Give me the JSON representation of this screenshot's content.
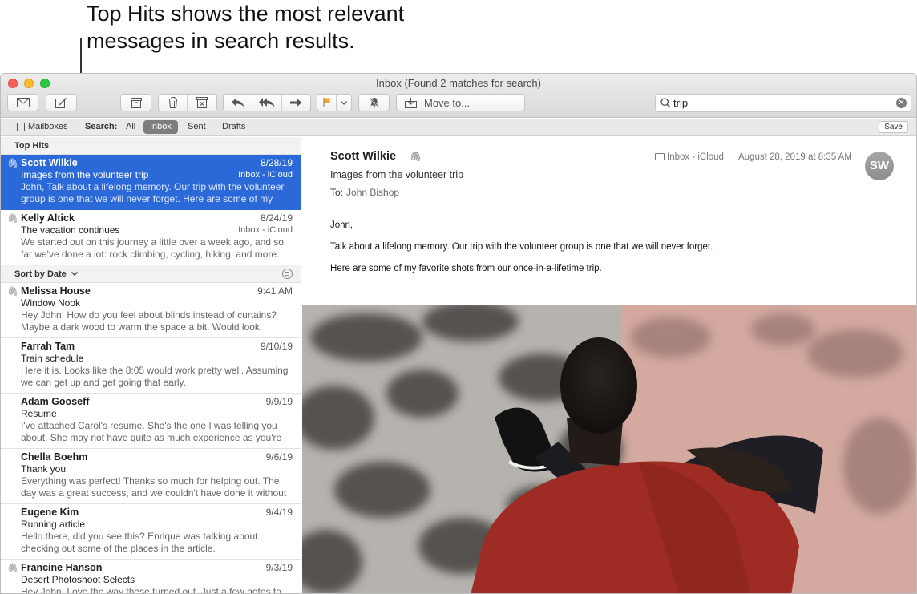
{
  "callout": {
    "line1": "Top Hits shows the most relevant",
    "line2": "messages in search results."
  },
  "window": {
    "title": "Inbox (Found 2 matches for search)"
  },
  "toolbar": {
    "move_to_label": "Move to...",
    "search_value": "trip"
  },
  "scopebar": {
    "mailboxes_label": "Mailboxes",
    "search_label": "Search:",
    "scopes": [
      "All",
      "Inbox",
      "Sent",
      "Drafts"
    ],
    "active_scope": "Inbox",
    "save_label": "Save"
  },
  "list": {
    "top_hits_label": "Top Hits",
    "sort_label": "Sort by Date",
    "top_hits": [
      {
        "sender": "Scott Wilkie",
        "date": "8/28/19",
        "subject": "Images from the volunteer trip",
        "mailbox": "Inbox - iCloud",
        "preview": "John, Talk about a lifelong memory. Our trip with the volunteer group is one that we will never forget. Here are some of my favorite shots.",
        "attachment": true
      },
      {
        "sender": "Kelly Altick",
        "date": "8/24/19",
        "subject": "The vacation continues",
        "mailbox": "Inbox - iCloud",
        "preview": "We started out on this journey a little over a week ago, and so far we've done a lot: rock climbing, cycling, hiking, and more.",
        "attachment": true
      }
    ],
    "messages": [
      {
        "sender": "Melissa House",
        "date": "9:41 AM",
        "subject": "Window Nook",
        "preview": "Hey John! How do you feel about blinds instead of curtains? Maybe a dark wood to warm the space a bit. Would look GREAT.",
        "attachment": true
      },
      {
        "sender": "Farrah Tam",
        "date": "9/10/19",
        "subject": "Train schedule",
        "preview": "Here it is. Looks like the 8:05 would work pretty well. Assuming we can get up and get going that early.",
        "attachment": false
      },
      {
        "sender": "Adam Gooseff",
        "date": "9/9/19",
        "subject": "Resume",
        "preview": "I've attached Carol's resume. She's the one I was telling you about. She may not have quite as much experience as you're looking for.",
        "attachment": false
      },
      {
        "sender": "Chella Boehm",
        "date": "9/6/19",
        "subject": "Thank you",
        "preview": "Everything was perfect! Thanks so much for helping out. The day was a great success, and we couldn't have done it without you.",
        "attachment": false
      },
      {
        "sender": "Eugene Kim",
        "date": "9/4/19",
        "subject": "Running article",
        "preview": "Hello there, did you see this? Enrique was talking about checking out some of the places in the article.",
        "attachment": false
      },
      {
        "sender": "Francine Hanson",
        "date": "9/3/19",
        "subject": "Desert Photoshoot Selects",
        "preview": "Hey John, Love the way these turned out. Just a few notes to help clean this up.",
        "attachment": true
      }
    ]
  },
  "reader": {
    "sender": "Scott Wilkie",
    "subject": "Images from the volunteer trip",
    "to_label": "To:",
    "to_name": "John Bishop",
    "folder": "Inbox - iCloud",
    "date": "August 28, 2019 at 8:35 AM",
    "avatar_initials": "SW",
    "body": [
      "John,",
      "Talk about a lifelong memory. Our trip with the volunteer group is one that we will never forget.",
      "Here are some of my favorite shots from our once-in-a-lifetime trip."
    ]
  },
  "colors": {
    "selection": "#2b69d9",
    "flag": "#f5a623"
  }
}
